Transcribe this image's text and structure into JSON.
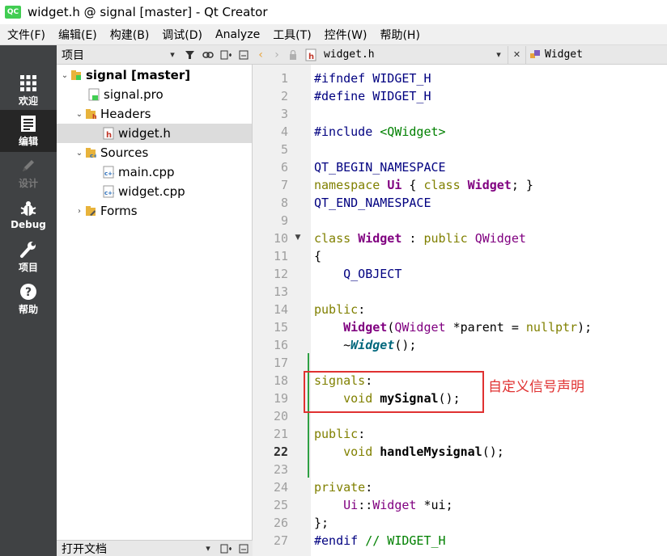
{
  "window": {
    "title": "widget.h @ signal [master] - Qt Creator",
    "logo_text": "QC"
  },
  "menu": [
    "文件(F)",
    "编辑(E)",
    "构建(B)",
    "调试(D)",
    "Analyze",
    "工具(T)",
    "控件(W)",
    "帮助(H)"
  ],
  "modes": [
    {
      "label": "欢迎",
      "icon": "grid-icon",
      "state": "normal"
    },
    {
      "label": "编辑",
      "icon": "document-icon",
      "state": "active"
    },
    {
      "label": "设计",
      "icon": "pencil-icon",
      "state": "disabled"
    },
    {
      "label": "Debug",
      "icon": "bug-icon",
      "state": "normal"
    },
    {
      "label": "项目",
      "icon": "wrench-icon",
      "state": "normal"
    },
    {
      "label": "帮助",
      "icon": "help-icon",
      "state": "normal"
    }
  ],
  "project_pane": {
    "title": "项目"
  },
  "tree": {
    "project": "signal [master]",
    "pro_file": "signal.pro",
    "headers": "Headers",
    "header_file": "widget.h",
    "sources": "Sources",
    "source_files": [
      "main.cpp",
      "widget.cpp"
    ],
    "forms": "Forms"
  },
  "open_docs_pane": {
    "title": "打开文档"
  },
  "editor": {
    "document": "widget.h",
    "symbol": "Widget",
    "current_line": 22,
    "line_numbers": [
      1,
      2,
      3,
      4,
      5,
      6,
      7,
      8,
      9,
      10,
      11,
      12,
      13,
      14,
      15,
      16,
      17,
      18,
      19,
      20,
      21,
      22,
      23,
      24,
      25,
      26,
      27
    ],
    "lines": [
      "#ifndef WIDGET_H",
      "#define WIDGET_H",
      "",
      "#include <QWidget>",
      "",
      "QT_BEGIN_NAMESPACE",
      "namespace Ui { class Widget; }",
      "QT_END_NAMESPACE",
      "",
      "class Widget : public QWidget",
      "{",
      "    Q_OBJECT",
      "",
      "public:",
      "    Widget(QWidget *parent = nullptr);",
      "    ~Widget();",
      "",
      "signals:",
      "    void mySignal();",
      "",
      "public:",
      "    void handleMysignal();",
      "",
      "private:",
      "    Ui::Widget *ui;",
      "};",
      "#endif // WIDGET_H"
    ]
  },
  "annotation": {
    "text": "自定义信号声明",
    "color": "#e03131"
  },
  "colors": {
    "sidebar": "#404244",
    "sidebar_active": "#262626",
    "gutter": "#f0f0f0",
    "diff_bar": "#2ea043"
  }
}
